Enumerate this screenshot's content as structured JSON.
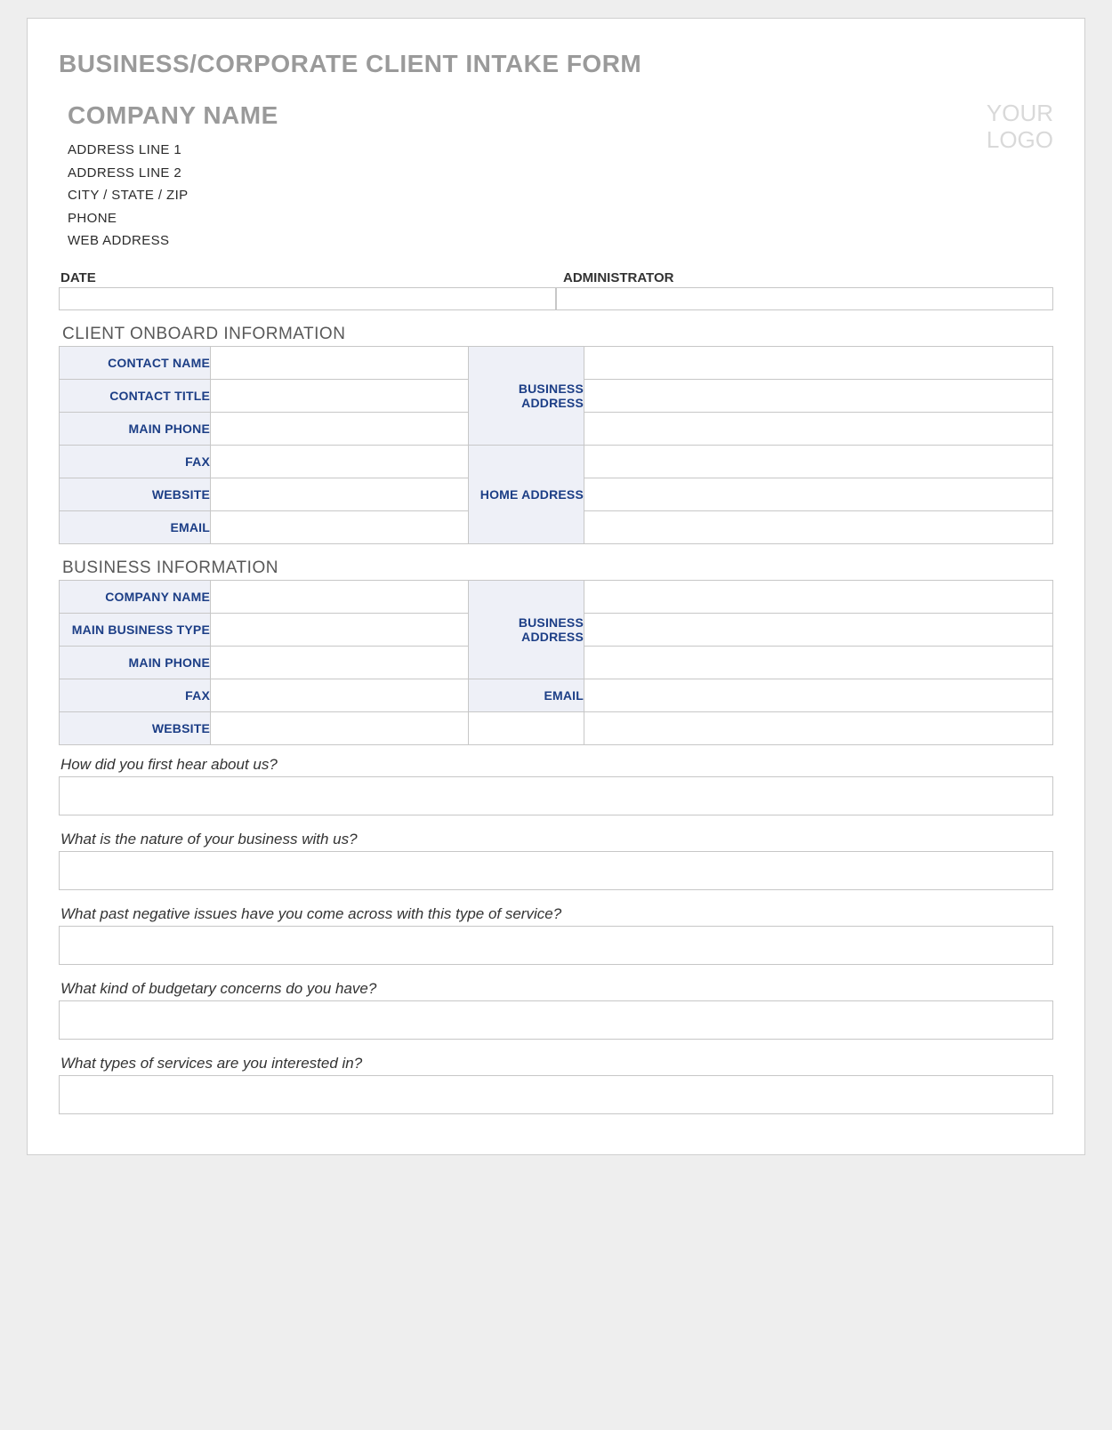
{
  "form_title": "BUSINESS/CORPORATE CLIENT INTAKE FORM",
  "company": {
    "name": "COMPANY NAME",
    "address1": "ADDRESS LINE 1",
    "address2": "ADDRESS LINE 2",
    "city_state_zip": "CITY / STATE / ZIP",
    "phone": "PHONE",
    "web": "WEB ADDRESS"
  },
  "logo": {
    "line1": "YOUR",
    "line2": "LOGO"
  },
  "da": {
    "date_label": "DATE",
    "admin_label": "ADMINISTRATOR"
  },
  "sections": {
    "onboard_title": "CLIENT ONBOARD INFORMATION",
    "business_title": "BUSINESS INFORMATION"
  },
  "onboard": {
    "contact_name": "CONTACT NAME",
    "contact_title": "CONTACT TITLE",
    "main_phone": "MAIN PHONE",
    "fax": "FAX",
    "website": "WEBSITE",
    "email": "EMAIL",
    "business_address": "BUSINESS ADDRESS",
    "home_address": "HOME ADDRESS"
  },
  "biz": {
    "company_name": "COMPANY NAME",
    "main_business_type": "MAIN BUSINESS TYPE",
    "main_phone": "MAIN PHONE",
    "fax": "FAX",
    "website": "WEBSITE",
    "business_address": "BUSINESS ADDRESS",
    "email": "EMAIL"
  },
  "questions": {
    "q1": "How did you first hear about us?",
    "q2": "What is the nature of your business with us?",
    "q3": "What past negative issues have you come across with this type of service?",
    "q4": "What kind of budgetary concerns do you have?",
    "q5": "What types of services are you interested in?"
  }
}
